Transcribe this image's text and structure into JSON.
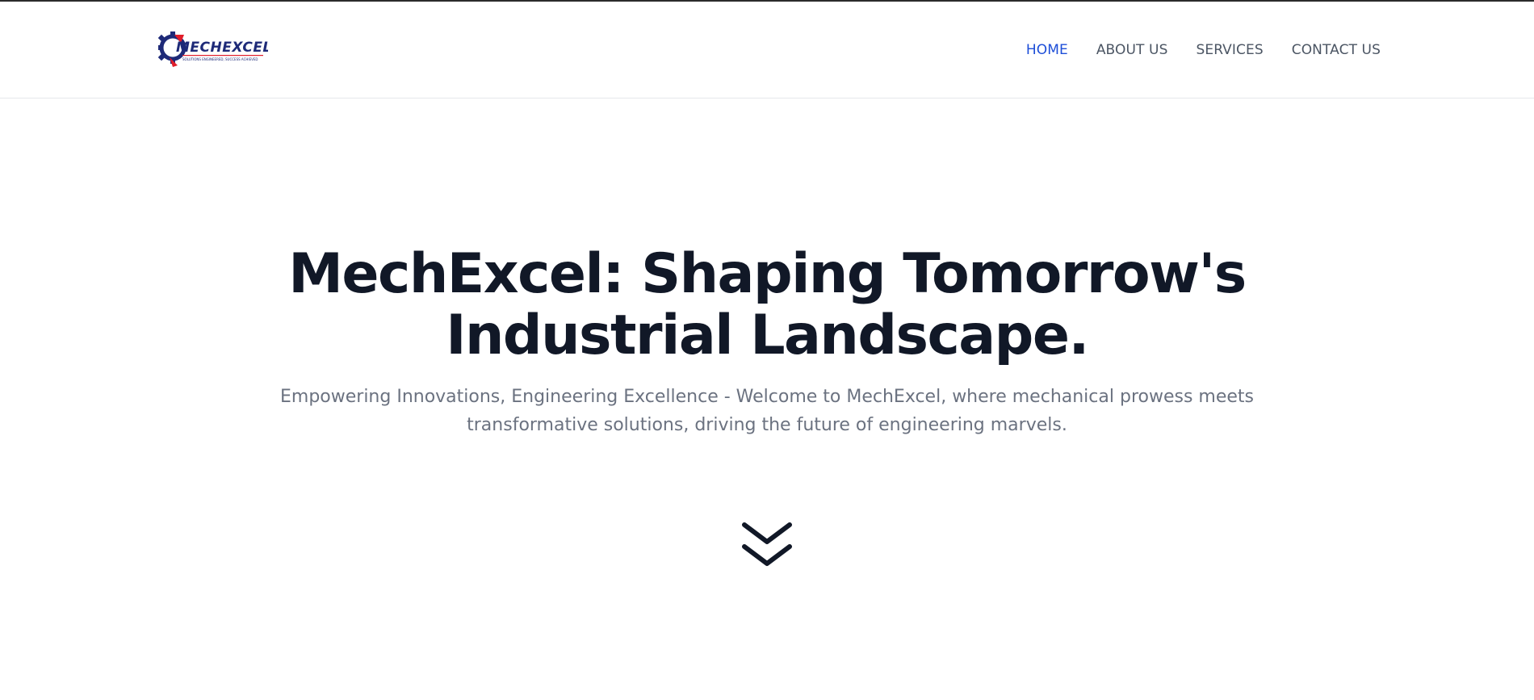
{
  "header": {
    "logo": {
      "text": "MECHEXCEL",
      "tagline": "SOLUTIONS ENGINEERED, SUCCESS ACHIEVED",
      "icon": "gear-icon",
      "colors": {
        "navy": "#1e2a78",
        "red": "#e11d2a"
      }
    },
    "nav": [
      {
        "label": "HOME",
        "active": true
      },
      {
        "label": "ABOUT US",
        "active": false
      },
      {
        "label": "SERVICES",
        "active": false
      },
      {
        "label": "CONTACT US",
        "active": false
      }
    ]
  },
  "hero": {
    "title": "MechExcel: Shaping Tomorrow's Industrial Landscape.",
    "subtitle": "Empowering Innovations, Engineering Excellence - Welcome to MechExcel, where mechanical prowess meets transformative solutions, driving the future of engineering marvels.",
    "scroll_icon": "double-chevron-down-icon"
  },
  "colors": {
    "text_dark": "#111827",
    "text_muted": "#6b7280",
    "nav_text": "#4b5563",
    "nav_active": "#1d4ed8",
    "background": "#ffffff"
  }
}
